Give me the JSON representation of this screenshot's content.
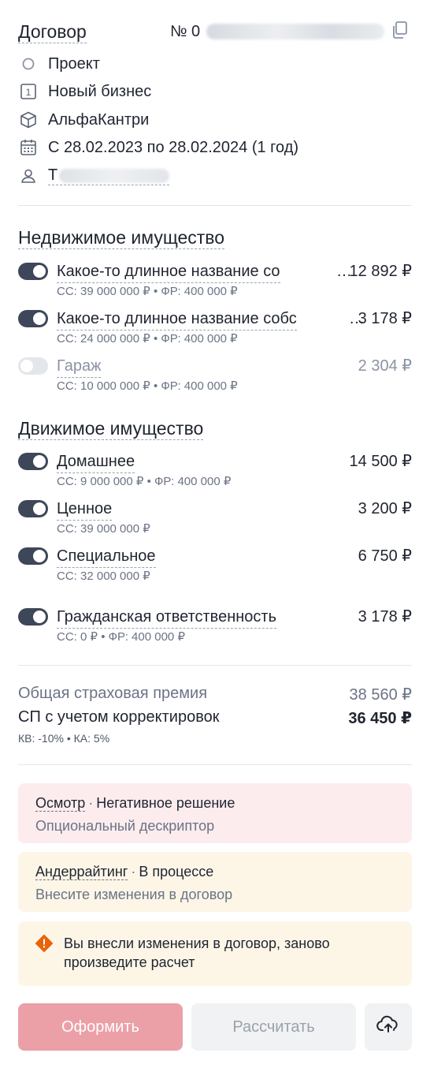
{
  "contract": {
    "title": "Договор",
    "number_prefix": "№ 0",
    "status": "Проект",
    "business_type": "Новый бизнес",
    "company": "АльфаКантри",
    "period": "С 28.02.2023 по 28.02.2024 (1 год)",
    "user_initial": "Т"
  },
  "real_estate": {
    "title": "Недвижимое имущество",
    "items": [
      {
        "name": "Какое-то длинное название со",
        "price": "12 892 ₽",
        "sub": "СС: 39 000 000 ₽ • ФР: 400 000 ₽",
        "enabled": true
      },
      {
        "name": "Какое-то длинное название собс",
        "price": "3 178 ₽",
        "sub": "СС: 24 000 000 ₽ • ФР: 400 000 ₽",
        "enabled": true
      },
      {
        "name": "Гараж",
        "price": "2 304 ₽",
        "sub": "СС: 10 000 000 ₽ • ФР: 400 000 ₽",
        "enabled": false
      }
    ]
  },
  "movable": {
    "title": "Движимое имущество",
    "items": [
      {
        "name": "Домашнее",
        "price": "14 500 ₽",
        "sub": "СС: 9 000 000 ₽ • ФР: 400 000 ₽",
        "enabled": true
      },
      {
        "name": "Ценное",
        "price": "3 200 ₽",
        "sub": "СС: 39 000 000 ₽",
        "enabled": true
      },
      {
        "name": "Специальное",
        "price": "6 750 ₽",
        "sub": "СС: 32 000 000 ₽",
        "enabled": true
      }
    ]
  },
  "liability": {
    "name": "Гражданская ответственность",
    "price": "3 178 ₽",
    "sub": "СС: 0 ₽ • ФР: 400 000 ₽",
    "enabled": true
  },
  "totals": {
    "premium_label": "Общая страховая премия",
    "premium_value": "38 560 ₽",
    "adjusted_label": "СП с учетом корректировок",
    "adjusted_value": "36 450 ₽",
    "sub": "КВ: -10%  •  КА: 5%"
  },
  "cards": {
    "inspection": {
      "link": "Осмотр",
      "status": "Негативное решение",
      "desc": "Опциональный дескриптор"
    },
    "underwriting": {
      "link": "Андеррайтинг",
      "status": "В процессе",
      "desc": "Внесите изменения в договор"
    },
    "warning": {
      "text": "Вы внесли изменения в договор, заново произведите расчет",
      "icon": "warning-icon"
    }
  },
  "buttons": {
    "submit": "Оформить",
    "calculate": "Рассчитать",
    "upload_icon": "upload-cloud-icon"
  },
  "colors": {
    "toggle_on": "#3e4759",
    "primary_button": "#eba0a8",
    "warning": "#e8640c",
    "card_error": "#fcecee",
    "card_warn": "#fdf6e7"
  }
}
